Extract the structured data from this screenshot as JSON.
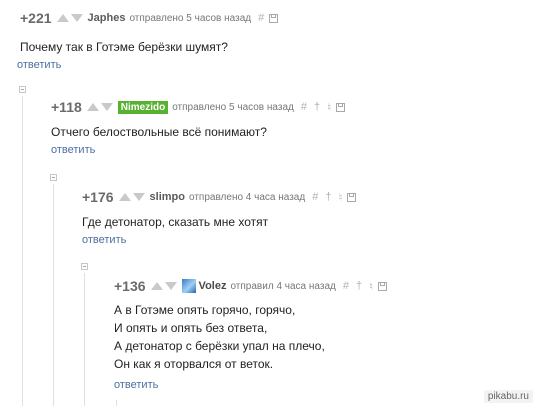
{
  "comments": [
    {
      "rating": "+221",
      "author": "Japhes",
      "time": "отправлено 5 часов назад",
      "icons": [
        "#"
      ],
      "text_lines": [
        "Почему так в Готэме берёзки шумят?"
      ],
      "reply": "ответить"
    },
    {
      "rating": "+118",
      "author": "Nimezido",
      "time": "отправлено 5 часов назад",
      "icons": [
        "#",
        "†",
        "♮"
      ],
      "text_lines": [
        "Отчего белоствольные всё понимают?"
      ],
      "reply": "ответить"
    },
    {
      "rating": "+176",
      "author": "slimpo",
      "time": "отправлено 4 часа назад",
      "icons": [
        "#",
        "†",
        "♮"
      ],
      "text_lines": [
        "Где детонатор, сказать мне хотят"
      ],
      "reply": "ответить"
    },
    {
      "rating": "+136",
      "author": "Volez",
      "time": "отправил 4 часа назад",
      "icons": [
        "#",
        "†",
        "♮"
      ],
      "text_lines": [
        "А в Готэме опять горячо, горячо,",
        "И опять и опять без ответа,",
        "А детонатор с берёзки упал на плечо,",
        "Он как я оторвался от веток."
      ],
      "reply": "ответить"
    }
  ],
  "watermark": "pikabu.ru",
  "colors": {
    "accent": "#4b6fa1",
    "badge": "#58b231",
    "text": "#222222"
  },
  "icon_names": [
    "up-vote-icon",
    "down-vote-icon",
    "hash-icon",
    "dagger-icon",
    "branch-icon",
    "save-icon",
    "collapse-icon"
  ]
}
